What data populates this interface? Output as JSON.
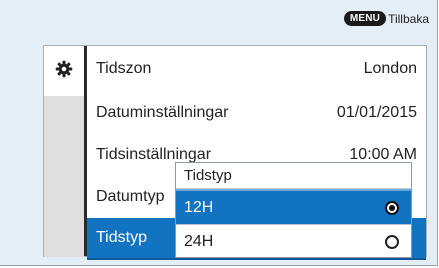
{
  "header": {
    "menu_key": "MENU",
    "back_label": "Tillbaka"
  },
  "sidebar": {
    "icon": "gear-icon"
  },
  "settings": {
    "rows": [
      {
        "label": "Tidszon",
        "value": "London"
      },
      {
        "label": "Datuminställningar",
        "value": "01/01/2015"
      },
      {
        "label": "Tidsinställningar",
        "value": "10:00 AM"
      },
      {
        "label": "Datumtyp",
        "value": ""
      },
      {
        "label": "Tidstyp",
        "value": ""
      }
    ],
    "selected_row": "Tidstyp"
  },
  "popup": {
    "title": "Tidstyp",
    "options": [
      {
        "label": "12H",
        "selected": true
      },
      {
        "label": "24H",
        "selected": false
      }
    ]
  },
  "colors": {
    "accent": "#1273c0",
    "background": "#e4eef7"
  }
}
